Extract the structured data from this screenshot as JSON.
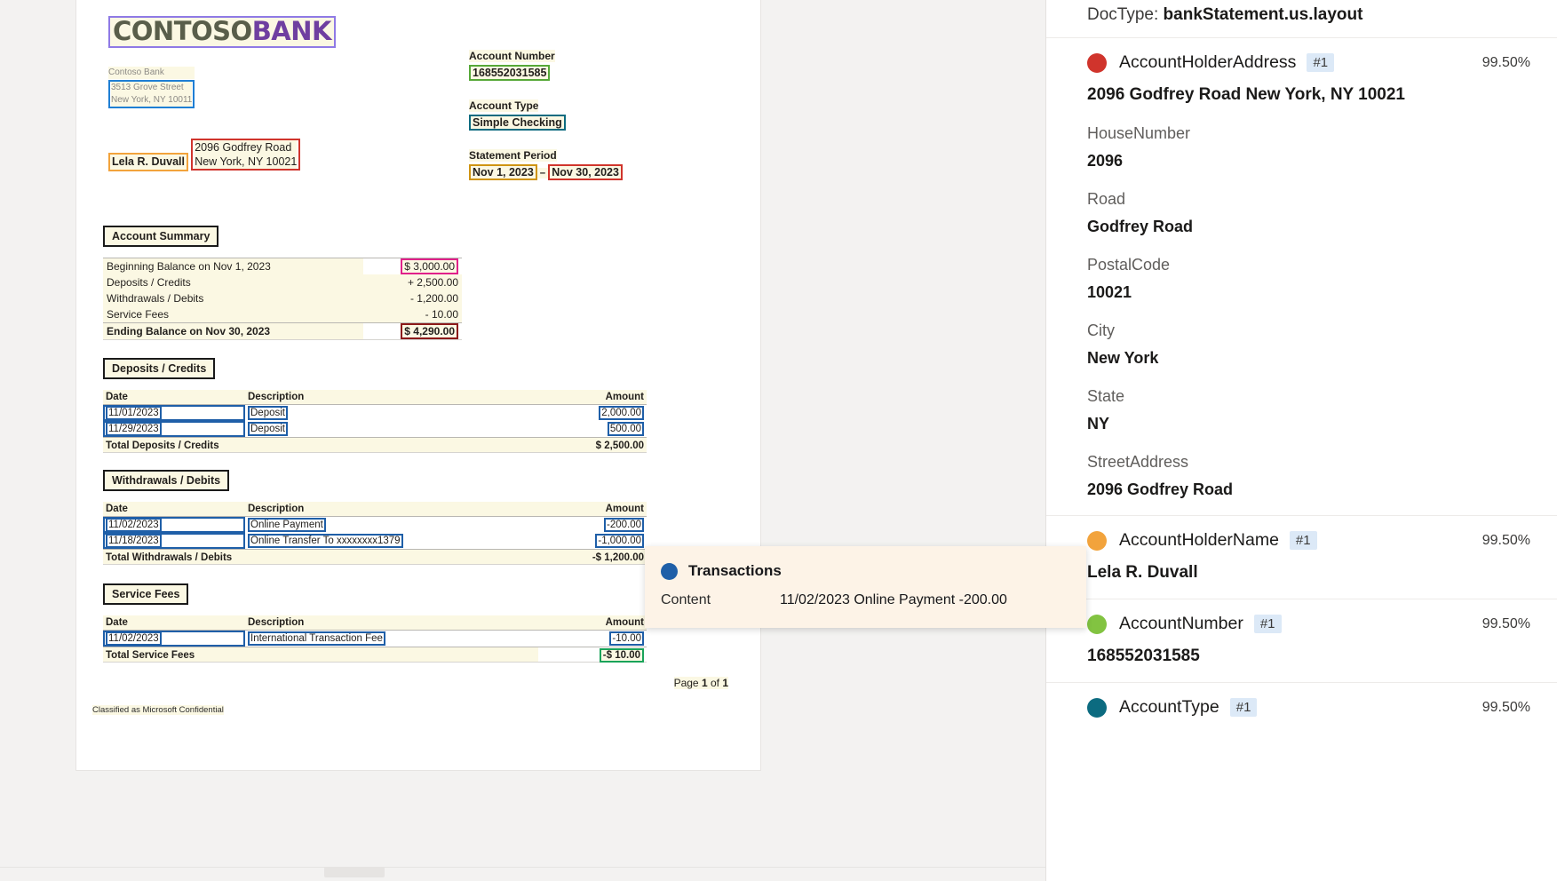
{
  "document": {
    "logo": {
      "word1": "CONTOSO",
      "word2": "BANK"
    },
    "bank_address": {
      "name": "Contoso Bank",
      "street": "3513 Grove Street",
      "city_state_zip": "New York, NY 10011"
    },
    "account_holder": {
      "name": "Lela R. Duvall",
      "street": "2096 Godfrey Road",
      "city_state_zip": "New York, NY 10021"
    },
    "meta": {
      "account_number_label": "Account Number",
      "account_number_value": "168552031585",
      "account_type_label": "Account Type",
      "account_type_value": "Simple Checking",
      "statement_period_label": "Statement Period",
      "statement_period_start": "Nov 1, 2023",
      "statement_period_dash": "–",
      "statement_period_end": "Nov 30, 2023"
    },
    "account_summary": {
      "title": "Account Summary",
      "rows": [
        {
          "label": "Beginning Balance on Nov 1, 2023",
          "amount": "$ 3,000.00"
        },
        {
          "label": "Deposits / Credits",
          "amount": "+ 2,500.00"
        },
        {
          "label": "Withdrawals / Debits",
          "amount": "- 1,200.00"
        },
        {
          "label": "Service Fees",
          "amount": "- 10.00"
        }
      ],
      "total_label": "Ending Balance on Nov 30, 2023",
      "total_amount": "$ 4,290.00"
    },
    "deposits": {
      "title": "Deposits / Credits",
      "columns": {
        "date": "Date",
        "description": "Description",
        "amount": "Amount"
      },
      "rows": [
        {
          "date": "11/01/2023",
          "description": "Deposit",
          "amount": "2,000.00"
        },
        {
          "date": "11/29/2023",
          "description": "Deposit",
          "amount": "500.00"
        }
      ],
      "total_label": "Total Deposits / Credits",
      "total_amount": "$ 2,500.00"
    },
    "withdrawals": {
      "title": "Withdrawals / Debits",
      "columns": {
        "date": "Date",
        "description": "Description",
        "amount": "Amount"
      },
      "rows": [
        {
          "date": "11/02/2023",
          "description": "Online Payment",
          "amount": "-200.00"
        },
        {
          "date": "11/18/2023",
          "description": "Online Transfer To xxxxxxxx1379",
          "amount": "-1,000.00"
        }
      ],
      "total_label": "Total Withdrawals / Debits",
      "total_amount": "-$ 1,200.00"
    },
    "service_fees": {
      "title": "Service Fees",
      "columns": {
        "date": "Date",
        "description": "Description",
        "amount": "Amount"
      },
      "rows": [
        {
          "date": "11/02/2023",
          "description": "International Transaction Fee",
          "amount": "-10.00"
        }
      ],
      "total_label": "Total Service Fees",
      "total_amount": "-$ 10.00"
    },
    "footer": {
      "page_prefix": "Page ",
      "page_current": "1",
      "page_mid": " of ",
      "page_total": "1",
      "classification": "Classified as Microsoft Confidential"
    }
  },
  "tooltip": {
    "title": "Transactions",
    "key": "Content",
    "value": "11/02/2023 Online Payment -200.00",
    "dot_color": "#1f5fa8"
  },
  "panel": {
    "doctype_label": "DocType:",
    "doctype_value": "bankStatement.us.layout",
    "fields": [
      {
        "name": "AccountHolderAddress",
        "index": "#1",
        "confidence": "99.50%",
        "dot_color": "#d0342c",
        "value": "2096 Godfrey Road New York, NY 10021",
        "subfields": [
          {
            "name": "HouseNumber",
            "value": "2096"
          },
          {
            "name": "Road",
            "value": "Godfrey Road"
          },
          {
            "name": "PostalCode",
            "value": "10021"
          },
          {
            "name": "City",
            "value": "New York"
          },
          {
            "name": "State",
            "value": "NY"
          },
          {
            "name": "StreetAddress",
            "value": "2096 Godfrey Road"
          }
        ]
      },
      {
        "name": "AccountHolderName",
        "index": "#1",
        "confidence": "99.50%",
        "dot_color": "#f2a33c",
        "value": "Lela R. Duvall",
        "subfields": []
      },
      {
        "name": "AccountNumber",
        "index": "#1",
        "confidence": "99.50%",
        "dot_color": "#82c341",
        "value": "168552031585",
        "subfields": []
      },
      {
        "name": "AccountType",
        "index": "#1",
        "confidence": "99.50%",
        "dot_color": "#0c6b80",
        "value": "",
        "subfields": []
      }
    ]
  }
}
